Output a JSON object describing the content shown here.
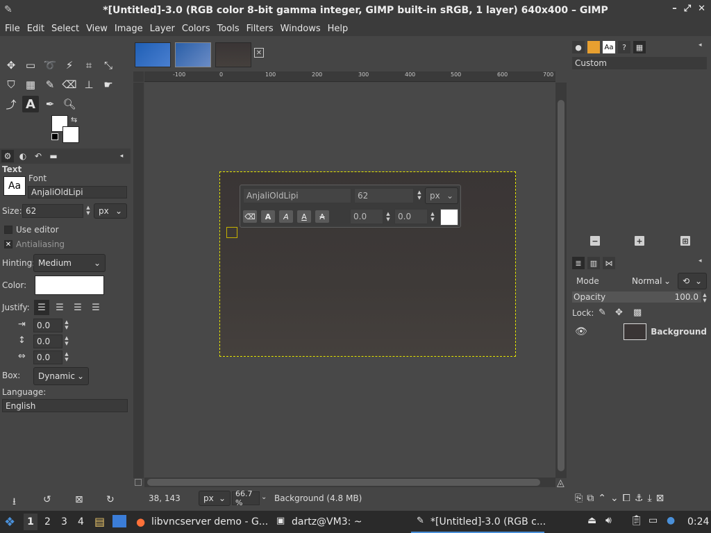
{
  "window": {
    "title": "*[Untitled]-3.0 (RGB color 8-bit gamma integer, GIMP built-in sRGB, 1 layer) 640x400 – GIMP"
  },
  "menu": [
    "File",
    "Edit",
    "Select",
    "View",
    "Image",
    "Layer",
    "Colors",
    "Tools",
    "Filters",
    "Windows",
    "Help"
  ],
  "tool_options": {
    "title": "Text",
    "font_label": "Font",
    "font_preview": "Aa",
    "font_value": "AnjaliOldLipi",
    "size_label": "Size:",
    "size_value": "62",
    "size_unit": "px",
    "use_editor": "Use editor",
    "antialiasing": "Antialiasing",
    "hinting_label": "Hinting:",
    "hinting_value": "Medium",
    "color_label": "Color:",
    "justify_label": "Justify:",
    "indent_value": "0.0",
    "line_spacing_value": "0.0",
    "letter_spacing_value": "0.0",
    "box_label": "Box:",
    "box_value": "Dynamic",
    "language_label": "Language:",
    "language_value": "English"
  },
  "ruler_h": [
    "-100",
    "0",
    "100",
    "200",
    "300",
    "400",
    "500",
    "600",
    "700"
  ],
  "text_style_editor": {
    "font": "AnjaliOldLipi",
    "size": "62",
    "unit": "px",
    "baseline": "0.0",
    "kerning": "0.0"
  },
  "status": {
    "coords": "38, 143",
    "unit": "px",
    "zoom": "66.7 %",
    "info": "Background (4.8 MB)"
  },
  "gradients": {
    "name": "Custom"
  },
  "layers": {
    "mode_label": "Mode",
    "mode_value": "Normal",
    "opacity_label": "Opacity",
    "opacity_value": "100.0",
    "lock_label": "Lock:",
    "layer_name": "Background"
  },
  "taskbar": {
    "workspaces": [
      "1",
      "2",
      "3",
      "4"
    ],
    "task1": "libvncserver demo - G...",
    "task2": "dartz@VM3: ~",
    "task3": "*[Untitled]-3.0 (RGB c...",
    "clock": "0:24"
  },
  "colors": {
    "accent_text_color": "#ffffff",
    "selection_border": "#e8e800"
  }
}
